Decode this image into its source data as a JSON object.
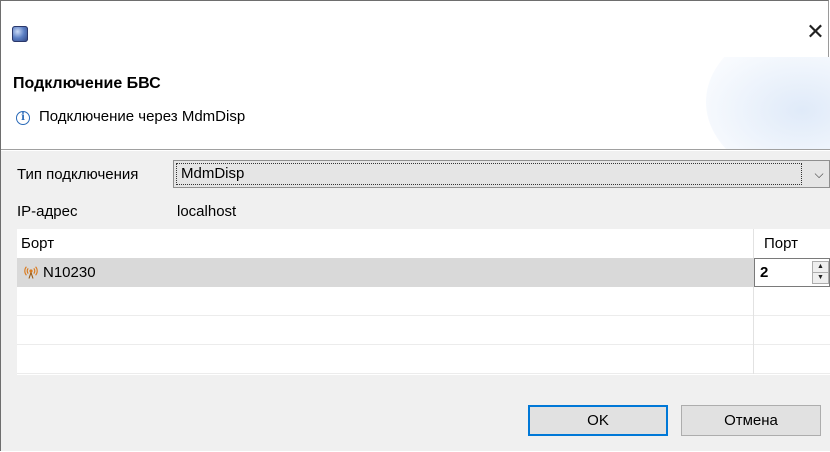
{
  "window": {
    "close_glyph": "✕"
  },
  "banner": {
    "title": "Подключение БВС",
    "message": "Подключение через MdmDisp",
    "info_icon": "info-icon"
  },
  "form": {
    "connection_type_label": "Тип подключения",
    "connection_type_value": "MdmDisp",
    "ip_label": "IP-адрес",
    "ip_value": "localhost"
  },
  "table": {
    "columns": [
      "Борт",
      "Порт"
    ],
    "rows": [
      {
        "board": "N10230",
        "icon": "antenna-icon",
        "port": "2",
        "selected": true
      }
    ]
  },
  "buttons": {
    "ok": "OK",
    "cancel": "Отмена"
  },
  "colors": {
    "accent": "#0078d7",
    "selected_row": "#d9d9d9",
    "form_bg": "#f0f0f0"
  }
}
